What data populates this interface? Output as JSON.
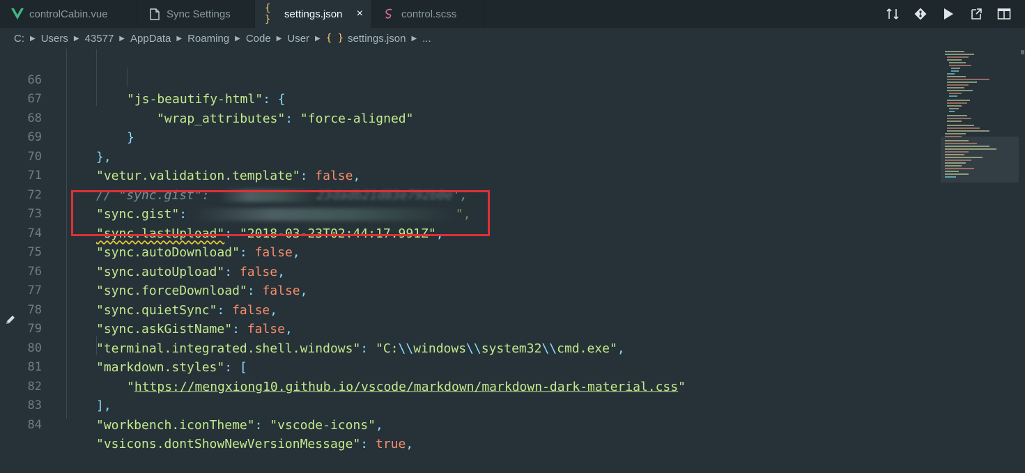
{
  "tabs": [
    {
      "label": "controlCabin.vue",
      "icon": "vue-icon"
    },
    {
      "label": "Sync Settings",
      "icon": "file-icon"
    },
    {
      "label": "settings.json",
      "icon": "json-braces-icon",
      "close": "×"
    },
    {
      "label": "control.scss",
      "icon": "sass-icon"
    }
  ],
  "breadcrumb": [
    "C:",
    "Users",
    "43577",
    "AppData",
    "Roaming",
    "Code",
    "User",
    "settings.json",
    "..."
  ],
  "line_numbers": [
    "66",
    "67",
    "68",
    "69",
    "70",
    "71",
    "72",
    "73",
    "74",
    "75",
    "76",
    "77",
    "78",
    "79",
    "80",
    "81",
    "82",
    "83",
    "84"
  ],
  "code": {
    "l66_key": "\"js-beautify-html\"",
    "l66_rest": ": {",
    "l67_key": "\"wrap_attributes\"",
    "l67_colon": ": ",
    "l67_val": "\"force-aligned\"",
    "l68": "}",
    "l69": "},",
    "l70_key": "\"vetur.validation.template\"",
    "l70_colon": ": ",
    "l70_val": "false",
    "l70_comma": ",",
    "l71_comment": "// \"sync.gist\":",
    "l71_tail": "23dadb21d83e792b0e",
    "l71_end": "',",
    "l72_key": "\"sync.gist\"",
    "l72_colon": ": ",
    "l72_end": "\",",
    "l73_key": "\"sync.lastUpload\"",
    "l73_colon": ": ",
    "l73_val": "\"2018-03-23T02:44:17.991Z\"",
    "l73_comma": ",",
    "l74_key": "\"sync.autoDownload\"",
    "l74_val": "false",
    "l75_key": "\"sync.autoUpload\"",
    "l75_val": "false",
    "l76_key": "\"sync.forceDownload\"",
    "l76_val": "false",
    "l77_key": "\"sync.quietSync\"",
    "l77_val": "false",
    "l78_key": "\"sync.askGistName\"",
    "l78_val": "false",
    "l79_key": "\"terminal.integrated.shell.windows\"",
    "l79_q1": "\"C:",
    "l79_e1": "\\\\",
    "l79_s1": "windows",
    "l79_e2": "\\\\",
    "l79_s2": "system32",
    "l79_e3": "\\\\",
    "l79_s3": "cmd.exe\"",
    "l80_key": "\"markdown.styles\"",
    "l80_rest": ": [",
    "l81_q": "\"",
    "l81_url": "https://mengxiong10.github.io/vscode/markdown/markdown-dark-material.css",
    "l82": "],",
    "l83_key": "\"workbench.iconTheme\"",
    "l83_val": "\"vscode-icons\"",
    "l84_key": "\"vsicons.dontShowNewVersionMessage\"",
    "l84_val": "true",
    "colon": ": ",
    "comma": ","
  },
  "colors": {
    "background": "#263238",
    "string": "#C3E88D",
    "punctuation": "#89DDFF",
    "keyword": "#F78C6C",
    "highlight_box": "#e02f36"
  },
  "actions": [
    "compare-icon",
    "git-icon",
    "run-icon",
    "open-preview-icon",
    "split-editor-icon"
  ]
}
